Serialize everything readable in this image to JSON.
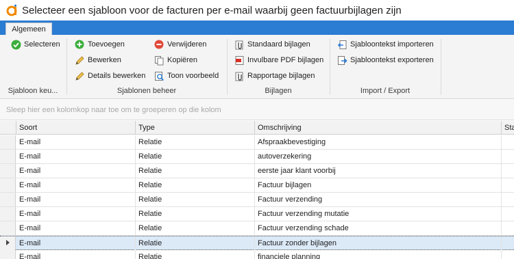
{
  "window": {
    "title": "Selecteer een sjabloon voor de facturen per e-mail waarbij geen factuurbijlagen zijn"
  },
  "ribbon": {
    "active_tab": "Algemeen",
    "groups": {
      "sjabloon_kiezen": {
        "label": "Sjabloon keu...",
        "selecteren": "Selecteren"
      },
      "sjablonen_beheer": {
        "label": "Sjablonen beheer",
        "toevoegen": "Toevoegen",
        "bewerken": "Bewerken",
        "details_bewerken": "Details bewerken",
        "verwijderen": "Verwijderen",
        "kopieren": "Kopiëren",
        "toon_voorbeeld": "Toon voorbeeld"
      },
      "bijlagen": {
        "label": "Bijlagen",
        "standaard_bijlagen": "Standaard bijlagen",
        "invulbare_pdf_bijlagen": "Invulbare PDF bijlagen",
        "rapportage_bijlagen": "Rapportage bijlagen"
      },
      "import_export": {
        "label": "Import / Export",
        "importeren": "Sjabloontekst importeren",
        "exporteren": "Sjabloontekst exporteren"
      }
    }
  },
  "groupby_panel": {
    "hint": "Sleep hier een kolomkop naar toe om te groeperen op die kolom"
  },
  "grid": {
    "columns": [
      "Soort",
      "Type",
      "Omschrijving",
      "Sta"
    ],
    "selected_row_index": 7,
    "rows": [
      {
        "soort": "E-mail",
        "type": "Relatie",
        "omschrijving": "Afspraakbevestiging"
      },
      {
        "soort": "E-mail",
        "type": "Relatie",
        "omschrijving": "autoverzekering"
      },
      {
        "soort": "E-mail",
        "type": "Relatie",
        "omschrijving": "eerste jaar klant voorbij"
      },
      {
        "soort": "E-mail",
        "type": "Relatie",
        "omschrijving": "Factuur bijlagen"
      },
      {
        "soort": "E-mail",
        "type": "Relatie",
        "omschrijving": "Factuur verzending"
      },
      {
        "soort": "E-mail",
        "type": "Relatie",
        "omschrijving": "Factuur verzending mutatie"
      },
      {
        "soort": "E-mail",
        "type": "Relatie",
        "omschrijving": "Factuur verzending schade"
      },
      {
        "soort": "E-mail",
        "type": "Relatie",
        "omschrijving": "Factuur zonder bijlagen"
      },
      {
        "soort": "E-mail",
        "type": "Relatie",
        "omschrijving": "financiele planning"
      }
    ]
  },
  "colors": {
    "accent_blue": "#2b7cd3",
    "logo_orange": "#f08a00",
    "selected_row": "#dce9f7"
  }
}
